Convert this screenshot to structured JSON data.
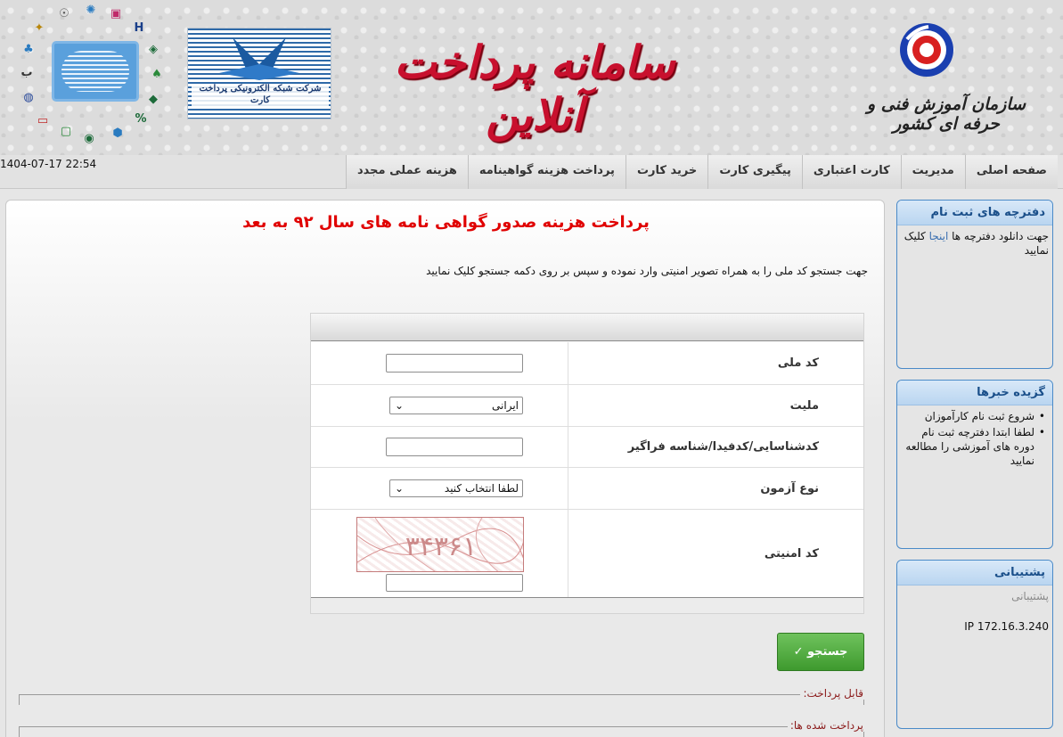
{
  "header": {
    "org_name": "سازمان آموزش فنی و حرفه ای کشور",
    "site_title": "سامانه پرداخت آنلاین",
    "shaparak_text": "شرکت شبکه الکترونیکی پرداخت کارت"
  },
  "clock": "1404-07-17 22:54",
  "nav": [
    {
      "label": "صفحه اصلی"
    },
    {
      "label": "مدیریت"
    },
    {
      "label": "کارت اعتباری"
    },
    {
      "label": "پیگیری کارت"
    },
    {
      "label": "خرید کارت"
    },
    {
      "label": "پرداخت هزینه گواهینامه"
    },
    {
      "label": "هزینه عملی مجدد"
    }
  ],
  "main": {
    "title": "پرداخت هزینه صدور گواهی نامه های سال ۹۲ به بعد",
    "instruction": "جهت جستجو کد ملی را به همراه تصویر امنیتی وارد نموده و سپس بر روی دکمه جستجو کلیک نمایید",
    "form": {
      "national_code_label": "کد ملی",
      "national_code_value": "",
      "nationality_label": "ملیت",
      "nationality_selected": "ایرانی",
      "id_label": "کدشناسایی/کدفیدا/شناسه فراگیر",
      "id_value": "",
      "exam_type_label": "نوع آزمون",
      "exam_type_selected": "لطفا انتخاب کنید",
      "captcha_label": "کد امنیتی",
      "captcha_digits": "۳۴۳۶۱",
      "captcha_value": ""
    },
    "search_button": "جستجو ✓",
    "payable_legend": "قابل پرداخت:",
    "paid_legend": "پرداخت شده ها:"
  },
  "sidebar": {
    "booklets": {
      "title": "دفترچه های ثبت نام",
      "text_before": "جهت دانلود دفترچه ها",
      "link": "اینجا",
      "text_after": "کلیک نمایید"
    },
    "news": {
      "title": "گزیده خبرها",
      "items": [
        "شروع ثبت نام کارآموزان",
        "لطفا ابتدا دفترچه ثبت نام دوره های آموزشی را مطالعه نمایید"
      ]
    },
    "support": {
      "title": "پشتیبانی",
      "subtitle": "پشتیبانی",
      "ip": "IP 172.16.3.240"
    }
  },
  "colors": {
    "title_red": "#e00000",
    "brand_blue": "#1a4f8a",
    "button_green": "#4aa83a"
  }
}
